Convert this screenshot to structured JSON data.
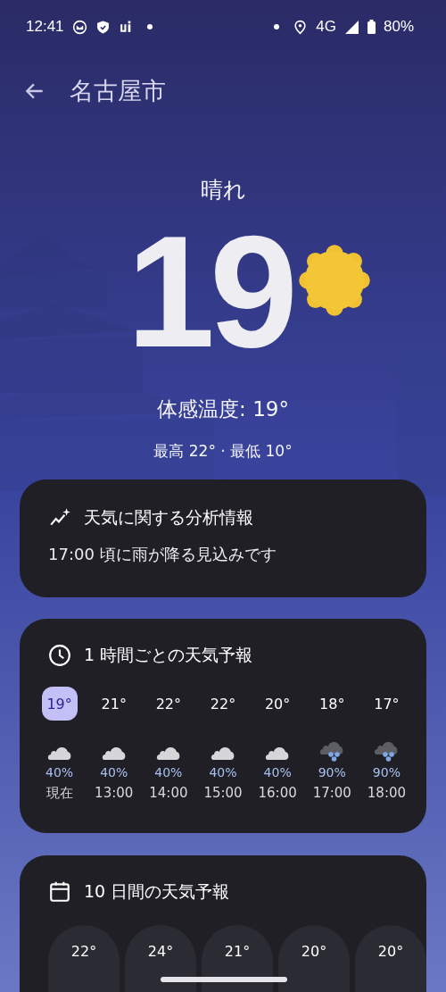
{
  "status_bar": {
    "time": "12:41",
    "network": "4G",
    "battery": "80%"
  },
  "header": {
    "title": "名古屋市"
  },
  "current": {
    "condition": "晴れ",
    "temperature": "19",
    "feels_like": "体感温度: 19°",
    "high_low": "最高 22° · 最低 10°"
  },
  "insight_card": {
    "title": "天気に関する分析情報",
    "text": "17:00 頃に雨が降る見込みです"
  },
  "hourly_card": {
    "title": "1 時間ごとの天気予報",
    "hours": [
      {
        "temp": "19°",
        "kind": "cloud",
        "precip": "40%",
        "time": "現在",
        "selected": true
      },
      {
        "temp": "21°",
        "kind": "cloud",
        "precip": "40%",
        "time": "13:00",
        "selected": false
      },
      {
        "temp": "22°",
        "kind": "cloud",
        "precip": "40%",
        "time": "14:00",
        "selected": false
      },
      {
        "temp": "22°",
        "kind": "cloud",
        "precip": "40%",
        "time": "15:00",
        "selected": false
      },
      {
        "temp": "20°",
        "kind": "cloud",
        "precip": "40%",
        "time": "16:00",
        "selected": false
      },
      {
        "temp": "18°",
        "kind": "rain",
        "precip": "90%",
        "time": "17:00",
        "selected": false
      },
      {
        "temp": "17°",
        "kind": "rain",
        "precip": "90%",
        "time": "18:00",
        "selected": false
      }
    ]
  },
  "daily_card": {
    "title": "10 日間の天気予報",
    "days": [
      {
        "temp": "22°"
      },
      {
        "temp": "24°"
      },
      {
        "temp": "21°"
      },
      {
        "temp": "20°"
      },
      {
        "temp": "20°"
      }
    ]
  }
}
